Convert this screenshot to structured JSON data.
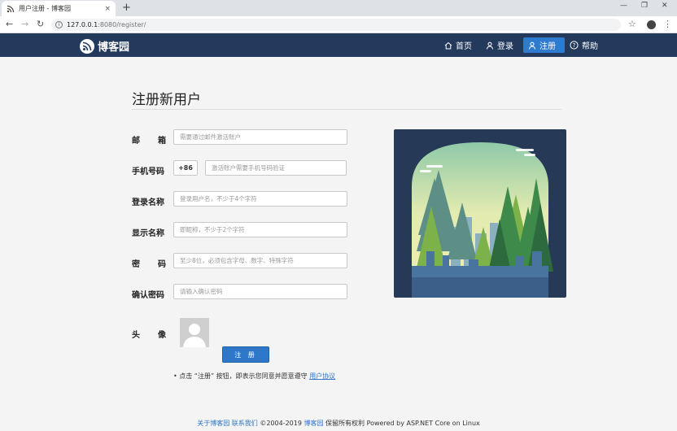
{
  "browser": {
    "tab_title": "用户注册 - 博客园",
    "tab_close": "×",
    "new_tab": "+",
    "url_host": "127.0.0.1",
    "url_path": ":8080/register/",
    "minimize": "—",
    "restore": "❐",
    "close": "✕",
    "back": "←",
    "forward": "→",
    "reload": "↻",
    "star": "☆",
    "menu": "⋮"
  },
  "site": {
    "logo_text": "博客园",
    "nav": [
      {
        "label": "首页",
        "icon": "home-icon"
      },
      {
        "label": "登录",
        "icon": "user-icon"
      },
      {
        "label": "注册",
        "icon": "user-add-icon"
      },
      {
        "label": "帮助",
        "icon": "help-icon"
      }
    ]
  },
  "form": {
    "title": "注册新用户",
    "fields": {
      "email": {
        "label_a": "邮",
        "label_b": "箱",
        "placeholder": "需要通过邮件激活账户"
      },
      "phone": {
        "label": "手机号码",
        "prefix": "+86",
        "placeholder": "激活账户需要手机号码验证"
      },
      "login_name": {
        "label": "登录名称",
        "placeholder": "登录用户名，不少于4个字符"
      },
      "display_name": {
        "label": "显示名称",
        "placeholder": "即昵称，不少于2个字符"
      },
      "password": {
        "label_a": "密",
        "label_b": "码",
        "placeholder": "至少8位，必须包含字母、数字、特殊字符"
      },
      "confirm_password": {
        "label": "确认密码",
        "placeholder": "请输入确认密码"
      },
      "avatar": {
        "label_a": "头",
        "label_b": "像"
      }
    },
    "submit_label": "注 册",
    "agreement_prefix": "• 点击 “注册” 按钮，即表示您同意并愿意遵守",
    "agreement_link": "用户协议"
  },
  "footer": {
    "about": "关于博客园",
    "contact": "联系我们",
    "copyright_a": "©2004-2019",
    "brand": "博客园",
    "copyright_b": "保留所有权利 Powered by ASP.NET Core on Linux"
  },
  "colors": {
    "nav_bg": "#233a5c",
    "accent": "#2e7bcf"
  }
}
